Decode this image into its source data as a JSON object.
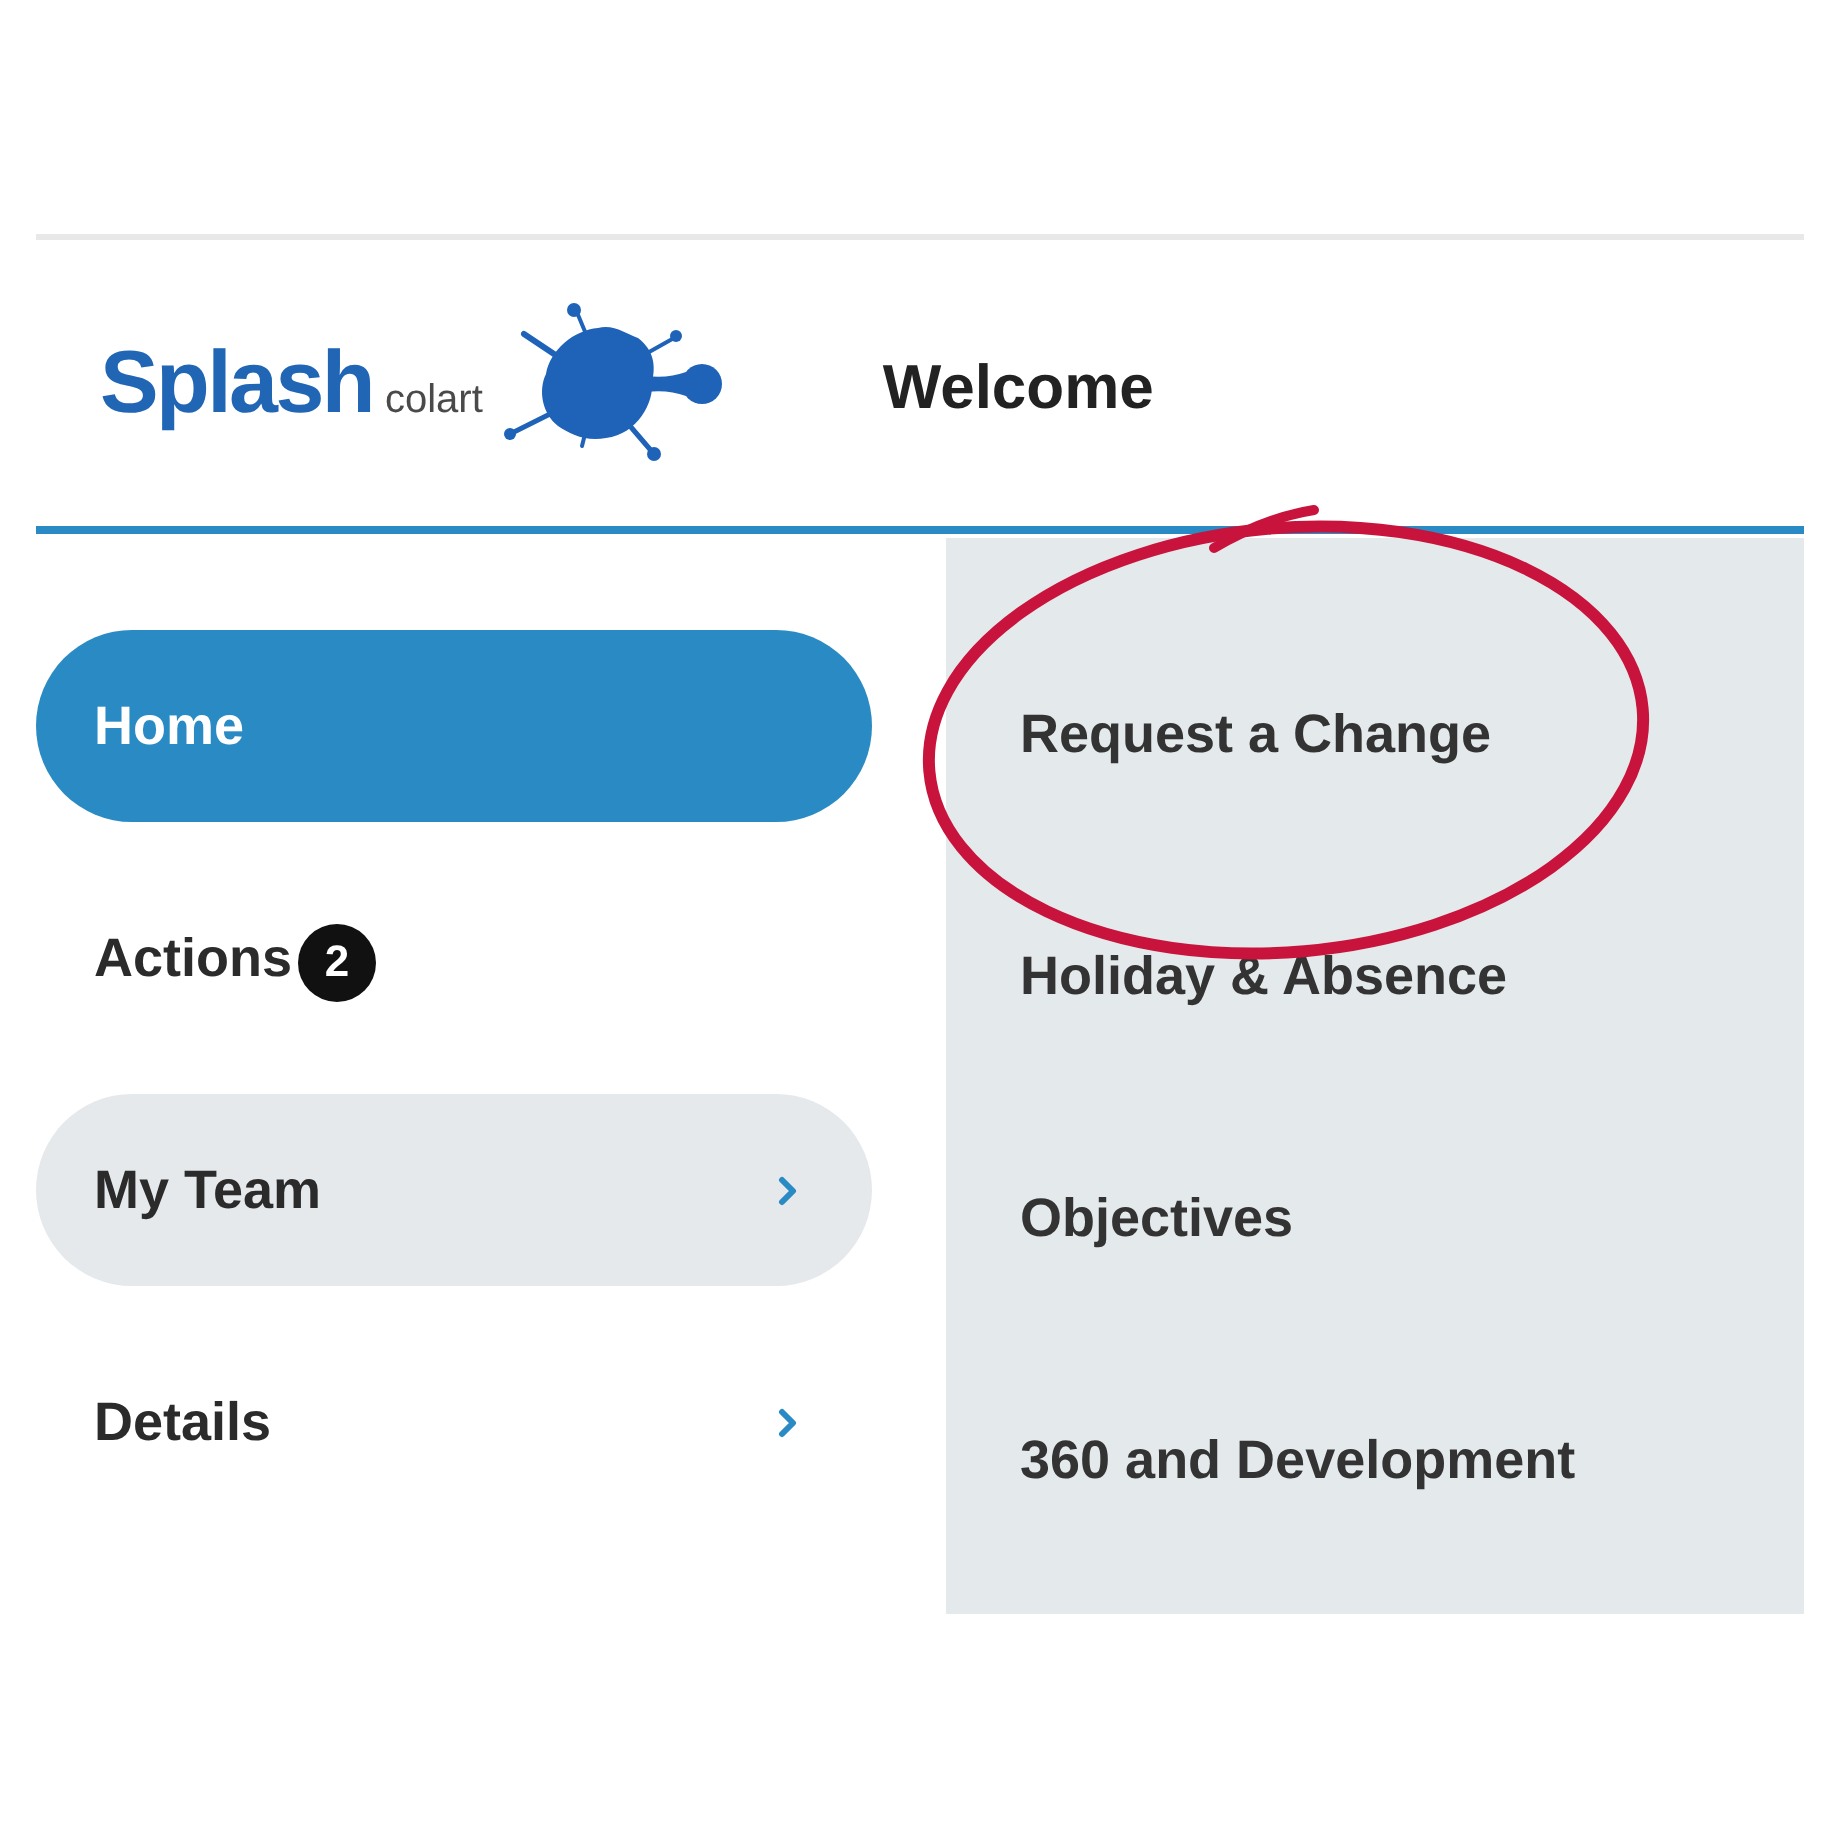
{
  "header": {
    "logo": {
      "name": "Splash",
      "subtitle": "colart"
    },
    "title": "Welcome"
  },
  "nav": {
    "items": [
      {
        "label": "Home",
        "selected": true,
        "expanded": false,
        "submenu": false
      },
      {
        "label": "Actions",
        "selected": false,
        "expanded": false,
        "submenu": false,
        "badge": "2"
      },
      {
        "label": "My Team",
        "selected": false,
        "expanded": true,
        "submenu": true
      },
      {
        "label": "Details",
        "selected": false,
        "expanded": false,
        "submenu": true
      }
    ]
  },
  "submenu": {
    "items": [
      {
        "label": "Request a Change",
        "circled": true
      },
      {
        "label": "Holiday & Absence",
        "circled": false
      },
      {
        "label": "Objectives",
        "circled": false
      },
      {
        "label": "360 and Development",
        "circled": false
      }
    ]
  }
}
